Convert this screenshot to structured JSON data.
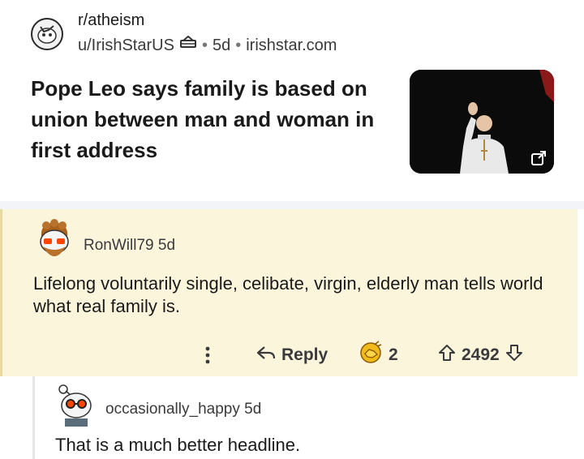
{
  "post": {
    "subreddit": "r/atheism",
    "author": "u/IrishStarUS",
    "age": "5d",
    "domain": "irishstar.com",
    "title": "Pope Leo says family is based on union between man and woman in first address"
  },
  "comments": [
    {
      "author": "RonWill79",
      "age": "5d",
      "body": "Lifelong voluntarily single, celibate, virgin, elderly man tells world what real family is.",
      "reply_label": "Reply",
      "award_count": "2",
      "vote_count": "2492"
    },
    {
      "author": "occasionally_happy",
      "age": "5d",
      "body": "That is a much better headline."
    }
  ],
  "icons": {
    "more": "vertical-ellipsis-icon",
    "reply": "reply-arrow-icon",
    "award": "award-icon",
    "upvote": "upvote-arrow-icon",
    "downvote": "downvote-arrow-icon",
    "external": "external-link-icon",
    "mod_badge": "shield-badge-icon"
  },
  "colors": {
    "highlight_bg": "#fbf5dc",
    "award_gold": "#e0a100",
    "text": "#1a1a1b",
    "muted": "#3a3a3c"
  }
}
